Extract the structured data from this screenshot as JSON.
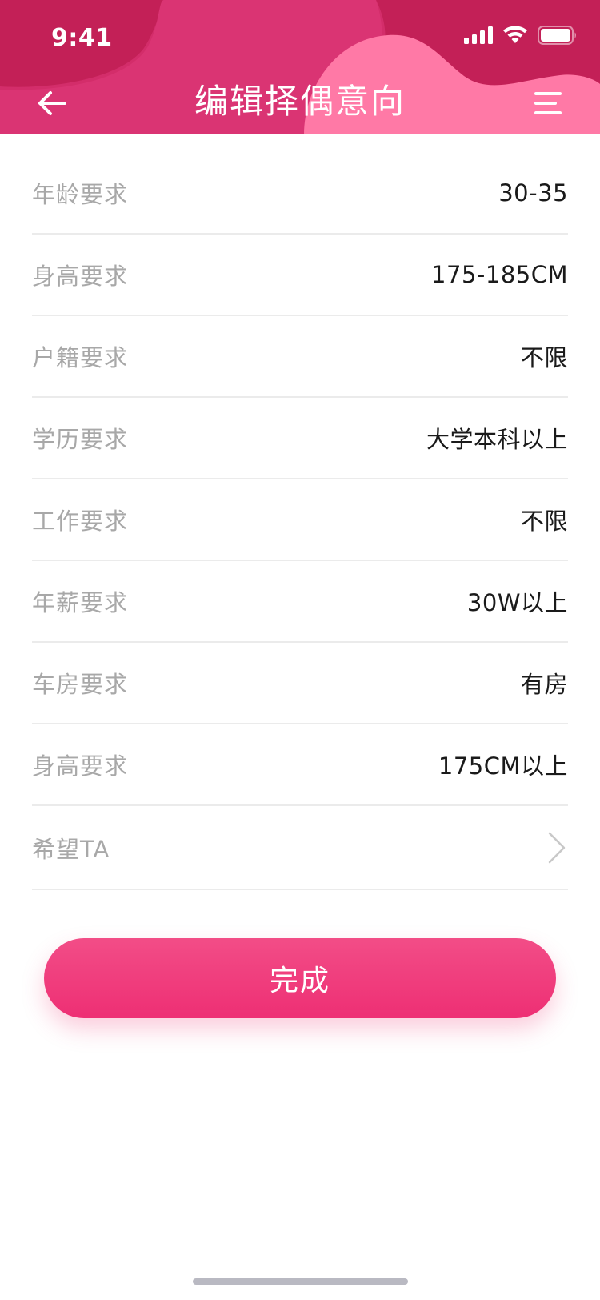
{
  "status_bar": {
    "time": "9:41"
  },
  "header": {
    "title": "编辑择偶意向",
    "back_icon": "arrow-left-icon",
    "menu_icon": "menu-icon"
  },
  "colors": {
    "header_dark": "#c32057",
    "header_mid": "#e0387a",
    "header_light": "#ff79a6",
    "button_top": "#f24d87",
    "button_bottom": "#ee2f74",
    "label": "#a8a8a8",
    "value": "#1a1a1a",
    "divider": "#ebebeb"
  },
  "preferences": [
    {
      "label": "年龄要求",
      "value": "30-35"
    },
    {
      "label": "身高要求",
      "value": "175-185CM"
    },
    {
      "label": "户籍要求",
      "value": "不限"
    },
    {
      "label": "学历要求",
      "value": "大学本科以上"
    },
    {
      "label": "工作要求",
      "value": "不限"
    },
    {
      "label": "年薪要求",
      "value": "30W以上"
    },
    {
      "label": "车房要求",
      "value": "有房"
    },
    {
      "label": "身高要求",
      "value": "175CM以上"
    },
    {
      "label": "希望TA",
      "value": ""
    }
  ],
  "actions": {
    "done_label": "完成"
  }
}
